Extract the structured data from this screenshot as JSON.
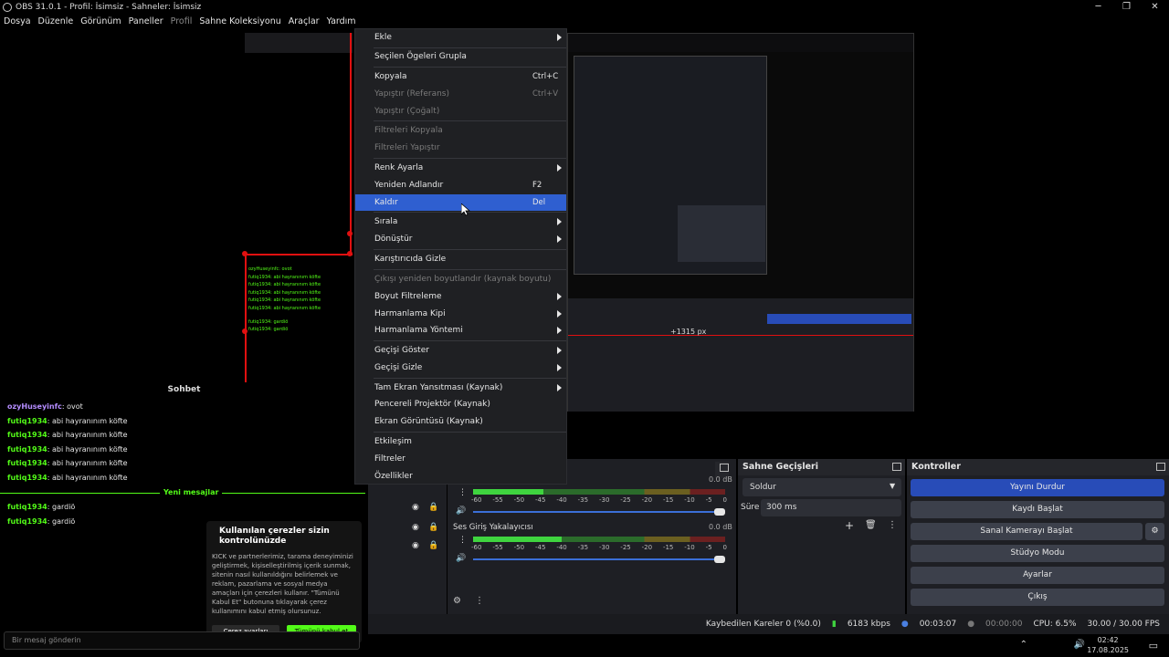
{
  "window": {
    "title": "OBS 31.0.1 - Profil: İsimsiz - Sahneler: İsimsiz",
    "minimize": "─",
    "maximize": "❐",
    "close": "✕"
  },
  "menubar": [
    "Dosya",
    "Düzenle",
    "Görünüm",
    "Paneller",
    "Profil",
    "Sahne Koleksiyonu",
    "Araçlar",
    "Yardım"
  ],
  "context_menu": {
    "items": [
      {
        "label": "Ekle",
        "submenu": true
      },
      {
        "label": "Seçilen Ögeleri Grupla"
      },
      {
        "label": "Kopyala",
        "shortcut": "Ctrl+C"
      },
      {
        "label": "Yapıştır (Referans)",
        "shortcut": "Ctrl+V",
        "disabled": true
      },
      {
        "label": "Yapıştır (Çoğalt)",
        "disabled": true
      },
      {
        "label": "Filtreleri Kopyala",
        "disabled": true
      },
      {
        "label": "Filtreleri Yapıştır",
        "disabled": true
      },
      {
        "label": "Renk Ayarla",
        "submenu": true
      },
      {
        "label": "Yeniden Adlandır",
        "shortcut": "F2"
      },
      {
        "label": "Kaldır",
        "shortcut": "Del",
        "highlighted": true
      },
      {
        "label": "Sırala",
        "submenu": true
      },
      {
        "label": "Dönüştür",
        "submenu": true
      },
      {
        "label": "Karıştırıcıda Gizle"
      },
      {
        "label": "Çıkışı yeniden boyutlandır (kaynak boyutu)",
        "disabled": true
      },
      {
        "label": "Boyut Filtreleme",
        "submenu": true
      },
      {
        "label": "Harmanlama Kipi",
        "submenu": true
      },
      {
        "label": "Harmanlama Yöntemi",
        "submenu": true
      },
      {
        "label": "Geçişi Göster",
        "submenu": true
      },
      {
        "label": "Geçişi Gizle",
        "submenu": true
      },
      {
        "label": "Tam Ekran Yansıtması (Kaynak)",
        "submenu": true
      },
      {
        "label": "Pencereli Projektör (Kaynak)"
      },
      {
        "label": "Ekran Görüntüsü (Kaynak)"
      },
      {
        "label": "Etkileşim"
      },
      {
        "label": "Filtreler"
      },
      {
        "label": "Özellikler"
      }
    ]
  },
  "chat": {
    "header": "Sohbet",
    "messages": [
      {
        "user": "ozyHuseyinfc",
        "text": "ovot",
        "color": "purple"
      },
      {
        "user": "futiq1934",
        "text": "abi hayranınım köfte"
      },
      {
        "user": "futiq1934",
        "text": "abi hayranınım köfte"
      },
      {
        "user": "futiq1934",
        "text": "abi hayranınım köfte"
      },
      {
        "user": "futiq1934",
        "text": "abi hayranınım köfte"
      },
      {
        "user": "futiq1934",
        "text": "abi hayranınım köfte"
      }
    ],
    "new_messages_label": "Yeni mesajlar",
    "after_messages": [
      {
        "user": "futiq1934",
        "text": "gardiö"
      },
      {
        "user": "futiq1934",
        "text": "gardiö"
      }
    ],
    "input_placeholder": "Bir mesaj gönderin",
    "cookie": {
      "title": "Kullanılan çerezler sizin kontrolünüzde",
      "body": "KICK ve partnerlerimiz, tarama deneyiminizi geliştirmek, kişiselleştirilmiş içerik sunmak, sitenin nasıl kullanıldığını belirlemek ve reklam, pazarlama ve sosyal medya amaçları için çerezleri kullanır. \"Tümünü Kabul Et\" butonuna tıklayarak çerez kullanımını kabul etmiş olursunuz.",
      "settings_button": "Çerez ayarları",
      "accept_button": "Tümünü kabul et"
    }
  },
  "mixer": {
    "tracks": [
      {
        "name": "",
        "db": "0.0 dB",
        "level": 0.28
      },
      {
        "name": "Ses Giriş Yakalayıcısı",
        "db": "0.0 dB",
        "level": 0.35
      }
    ],
    "scale": [
      "-60",
      "-55",
      "-50",
      "-45",
      "-40",
      "-35",
      "-30",
      "-25",
      "-20",
      "-15",
      "-10",
      "-5",
      "0"
    ]
  },
  "transitions": {
    "title": "Sahne Geçişleri",
    "selected": "Soldur",
    "duration_label": "Süre",
    "duration_value": "300 ms"
  },
  "controls": {
    "title": "Kontroller",
    "buttons": [
      "Yayını Durdur",
      "Kaydı Başlat",
      "Sanal Kamerayı Başlat",
      "Stüdyo Modu",
      "Ayarlar",
      "Çıkış"
    ]
  },
  "status": {
    "dropped": "Kaybedilen Kareler 0 (%0.0)",
    "bitrate": "6183 kbps",
    "stream_time": "00:03:07",
    "rec_time": "00:00:00",
    "cpu": "CPU: 6.5%",
    "fps": "30.00 / 30.00 FPS"
  },
  "taskbar": {
    "time": "02:42",
    "date": "17.08.2025"
  },
  "preview_text": {
    "nested_label": "+1315 px",
    "nested_chat": [
      "ozyHuseyinfc: ovot",
      "futiq1934: abi hayranınım köfte",
      "futiq1934: abi hayranınım köfte",
      "futiq1934: abi hayranınım köfte",
      "futiq1934: abi hayranınım köfte",
      "futiq1934: abi hayranınım köfte",
      "futiq1934: gardiö",
      "futiq1934: gardiö"
    ]
  },
  "colors": {
    "accent": "#284cb8",
    "highlight": "#2f5fd0",
    "kick_green": "#53fc18",
    "bounding_red": "#e01010"
  }
}
